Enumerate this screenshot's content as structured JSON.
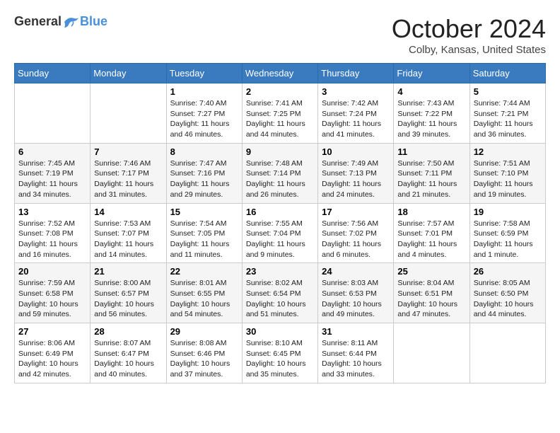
{
  "header": {
    "logo_general": "General",
    "logo_blue": "Blue",
    "month_title": "October 2024",
    "location": "Colby, Kansas, United States"
  },
  "days_of_week": [
    "Sunday",
    "Monday",
    "Tuesday",
    "Wednesday",
    "Thursday",
    "Friday",
    "Saturday"
  ],
  "weeks": [
    [
      {
        "day": "",
        "info": ""
      },
      {
        "day": "",
        "info": ""
      },
      {
        "day": "1",
        "info": "Sunrise: 7:40 AM\nSunset: 7:27 PM\nDaylight: 11 hours and 46 minutes."
      },
      {
        "day": "2",
        "info": "Sunrise: 7:41 AM\nSunset: 7:25 PM\nDaylight: 11 hours and 44 minutes."
      },
      {
        "day": "3",
        "info": "Sunrise: 7:42 AM\nSunset: 7:24 PM\nDaylight: 11 hours and 41 minutes."
      },
      {
        "day": "4",
        "info": "Sunrise: 7:43 AM\nSunset: 7:22 PM\nDaylight: 11 hours and 39 minutes."
      },
      {
        "day": "5",
        "info": "Sunrise: 7:44 AM\nSunset: 7:21 PM\nDaylight: 11 hours and 36 minutes."
      }
    ],
    [
      {
        "day": "6",
        "info": "Sunrise: 7:45 AM\nSunset: 7:19 PM\nDaylight: 11 hours and 34 minutes."
      },
      {
        "day": "7",
        "info": "Sunrise: 7:46 AM\nSunset: 7:17 PM\nDaylight: 11 hours and 31 minutes."
      },
      {
        "day": "8",
        "info": "Sunrise: 7:47 AM\nSunset: 7:16 PM\nDaylight: 11 hours and 29 minutes."
      },
      {
        "day": "9",
        "info": "Sunrise: 7:48 AM\nSunset: 7:14 PM\nDaylight: 11 hours and 26 minutes."
      },
      {
        "day": "10",
        "info": "Sunrise: 7:49 AM\nSunset: 7:13 PM\nDaylight: 11 hours and 24 minutes."
      },
      {
        "day": "11",
        "info": "Sunrise: 7:50 AM\nSunset: 7:11 PM\nDaylight: 11 hours and 21 minutes."
      },
      {
        "day": "12",
        "info": "Sunrise: 7:51 AM\nSunset: 7:10 PM\nDaylight: 11 hours and 19 minutes."
      }
    ],
    [
      {
        "day": "13",
        "info": "Sunrise: 7:52 AM\nSunset: 7:08 PM\nDaylight: 11 hours and 16 minutes."
      },
      {
        "day": "14",
        "info": "Sunrise: 7:53 AM\nSunset: 7:07 PM\nDaylight: 11 hours and 14 minutes."
      },
      {
        "day": "15",
        "info": "Sunrise: 7:54 AM\nSunset: 7:05 PM\nDaylight: 11 hours and 11 minutes."
      },
      {
        "day": "16",
        "info": "Sunrise: 7:55 AM\nSunset: 7:04 PM\nDaylight: 11 hours and 9 minutes."
      },
      {
        "day": "17",
        "info": "Sunrise: 7:56 AM\nSunset: 7:02 PM\nDaylight: 11 hours and 6 minutes."
      },
      {
        "day": "18",
        "info": "Sunrise: 7:57 AM\nSunset: 7:01 PM\nDaylight: 11 hours and 4 minutes."
      },
      {
        "day": "19",
        "info": "Sunrise: 7:58 AM\nSunset: 6:59 PM\nDaylight: 11 hours and 1 minute."
      }
    ],
    [
      {
        "day": "20",
        "info": "Sunrise: 7:59 AM\nSunset: 6:58 PM\nDaylight: 10 hours and 59 minutes."
      },
      {
        "day": "21",
        "info": "Sunrise: 8:00 AM\nSunset: 6:57 PM\nDaylight: 10 hours and 56 minutes."
      },
      {
        "day": "22",
        "info": "Sunrise: 8:01 AM\nSunset: 6:55 PM\nDaylight: 10 hours and 54 minutes."
      },
      {
        "day": "23",
        "info": "Sunrise: 8:02 AM\nSunset: 6:54 PM\nDaylight: 10 hours and 51 minutes."
      },
      {
        "day": "24",
        "info": "Sunrise: 8:03 AM\nSunset: 6:53 PM\nDaylight: 10 hours and 49 minutes."
      },
      {
        "day": "25",
        "info": "Sunrise: 8:04 AM\nSunset: 6:51 PM\nDaylight: 10 hours and 47 minutes."
      },
      {
        "day": "26",
        "info": "Sunrise: 8:05 AM\nSunset: 6:50 PM\nDaylight: 10 hours and 44 minutes."
      }
    ],
    [
      {
        "day": "27",
        "info": "Sunrise: 8:06 AM\nSunset: 6:49 PM\nDaylight: 10 hours and 42 minutes."
      },
      {
        "day": "28",
        "info": "Sunrise: 8:07 AM\nSunset: 6:47 PM\nDaylight: 10 hours and 40 minutes."
      },
      {
        "day": "29",
        "info": "Sunrise: 8:08 AM\nSunset: 6:46 PM\nDaylight: 10 hours and 37 minutes."
      },
      {
        "day": "30",
        "info": "Sunrise: 8:10 AM\nSunset: 6:45 PM\nDaylight: 10 hours and 35 minutes."
      },
      {
        "day": "31",
        "info": "Sunrise: 8:11 AM\nSunset: 6:44 PM\nDaylight: 10 hours and 33 minutes."
      },
      {
        "day": "",
        "info": ""
      },
      {
        "day": "",
        "info": ""
      }
    ]
  ]
}
